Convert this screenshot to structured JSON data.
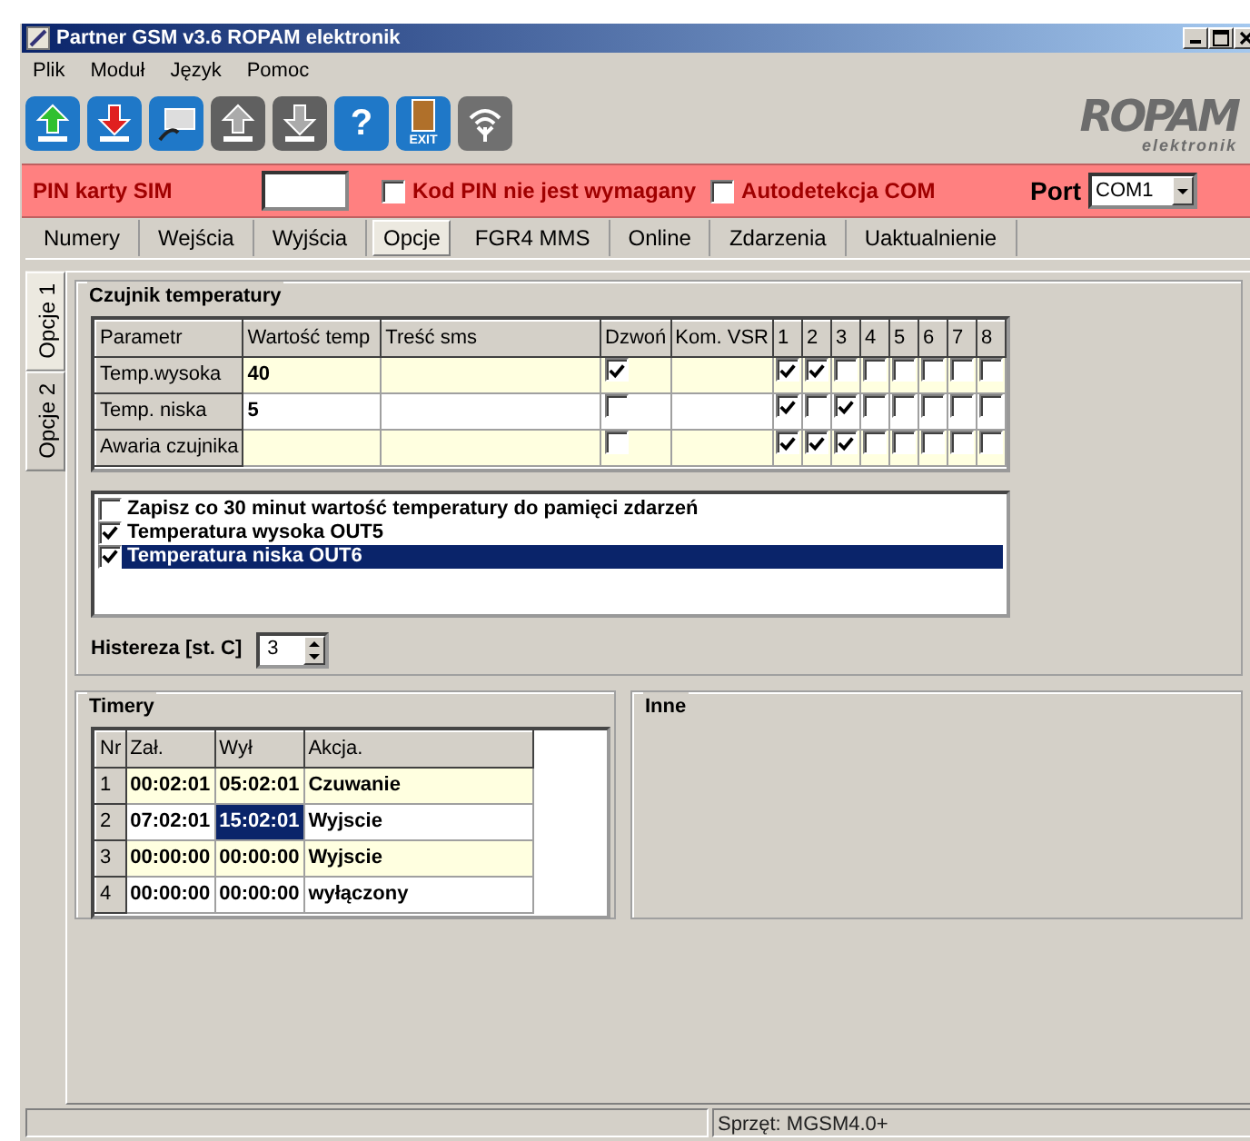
{
  "window": {
    "title": "Partner GSM v3.6 ROPAM elektronik"
  },
  "menu": [
    "Plik",
    "Moduł",
    "Język",
    "Pomoc"
  ],
  "toolbar": [
    {
      "kind": "upload"
    },
    {
      "kind": "download"
    },
    {
      "kind": "connect"
    },
    {
      "kind": "upload-gray"
    },
    {
      "kind": "download-gray"
    },
    {
      "kind": "help",
      "label": "?"
    },
    {
      "kind": "exit",
      "label": "EXIT"
    },
    {
      "kind": "wireless"
    }
  ],
  "logo": {
    "name": "ROPAM",
    "subtitle": "elektronik"
  },
  "pin_bar": {
    "pin_label": "PIN karty SIM",
    "pin_not_required": {
      "label": "Kod PIN nie jest wymagany",
      "checked": false
    },
    "autodetect": {
      "label": "Autodetekcja COM",
      "checked": false
    },
    "port_label": "Port",
    "port_value": "COM1"
  },
  "tabs": [
    {
      "label": "Numery",
      "selected": false
    },
    {
      "label": "Wejścia",
      "selected": false
    },
    {
      "label": "Wyjścia",
      "selected": false
    },
    {
      "label": "Opcje",
      "selected": true
    },
    {
      "label": "FGR4 MMS",
      "selected": false
    },
    {
      "label": "Online",
      "selected": false
    },
    {
      "label": "Zdarzenia",
      "selected": false
    },
    {
      "label": "Uaktualnienie",
      "selected": false
    }
  ],
  "side_tabs": [
    {
      "label": "Opcje 1",
      "selected": true
    },
    {
      "label": "Opcje 2",
      "selected": false
    }
  ],
  "sensor_group": {
    "title": "Czujnik temperatury",
    "columns": [
      "Parametr",
      "Wartość temp",
      "Treść sms",
      "Dzwoń",
      "Kom. VSR",
      "1",
      "2",
      "3",
      "4",
      "5",
      "6",
      "7",
      "8"
    ],
    "rows": [
      {
        "parameter": "Temp.wysoka",
        "value": "40",
        "call": true,
        "outputs": [
          true,
          true,
          false,
          false,
          false,
          false,
          false,
          false
        ]
      },
      {
        "parameter": "Temp. niska",
        "value": "5",
        "call": false,
        "outputs": [
          true,
          false,
          true,
          false,
          false,
          false,
          false,
          false
        ]
      },
      {
        "parameter": "Awaria czujnika",
        "call": false,
        "outputs": [
          true,
          true,
          true,
          false,
          false,
          false,
          false,
          false
        ]
      }
    ],
    "options": [
      {
        "label": "Zapisz co 30 minut wartość temperatury do pamięci zdarzeń",
        "checked": false,
        "selected": false
      },
      {
        "label": "Temperatura wysoka OUT5",
        "checked": true,
        "selected": false
      },
      {
        "label": "Temperatura niska OUT6",
        "checked": true,
        "selected": true
      }
    ],
    "hysteresis_label": "Histereza [st. C]",
    "hysteresis_value": "3"
  },
  "timers": {
    "title": "Timery",
    "columns": [
      "Nr",
      "Zał.",
      "Wył",
      "Akcja."
    ],
    "rows": [
      {
        "cells": [
          {
            "text": "1",
            "selected": false
          },
          {
            "text": "00:02:01",
            "selected": false
          },
          {
            "text": "05:02:01",
            "selected": false
          },
          {
            "text": "Czuwanie",
            "selected": false
          }
        ]
      },
      {
        "cells": [
          {
            "text": "2",
            "selected": false
          },
          {
            "text": "07:02:01",
            "selected": false
          },
          {
            "text": "15:02:01",
            "selected": true
          },
          {
            "text": "Wyjscie",
            "selected": false
          }
        ]
      },
      {
        "cells": [
          {
            "text": "3",
            "selected": false
          },
          {
            "text": "00:00:00",
            "selected": false
          },
          {
            "text": "00:00:00",
            "selected": false
          },
          {
            "text": "Wyjscie",
            "selected": false
          }
        ]
      },
      {
        "cells": [
          {
            "text": "4",
            "selected": false
          },
          {
            "text": "00:00:00",
            "selected": false
          },
          {
            "text": "00:00:00",
            "selected": false
          },
          {
            "text": "wyłączony",
            "selected": false
          }
        ]
      }
    ]
  },
  "other_group": {
    "title": "Inne"
  },
  "status_bar": {
    "hardware": "Sprzęt: MGSM4.0+"
  }
}
